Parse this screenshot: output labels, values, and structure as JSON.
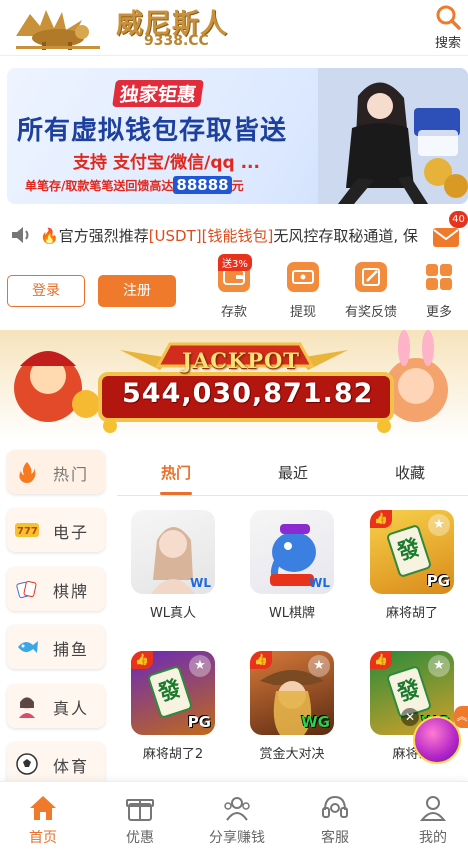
{
  "header": {
    "brand": "威尼斯人",
    "domain": "9338.CC",
    "search_label": "搜索"
  },
  "banner": {
    "tag": "独家钜惠",
    "headline": "所有虚拟钱包存取皆送",
    "sub": "支持 支付宝/微信/qq ...",
    "note": "单笔存/取款笔笔送回馈高达",
    "amount": "88888",
    "unit": "元"
  },
  "notice": {
    "prefix": "官方强烈推荐",
    "hl1": "[USDT]",
    "hl2": "[钱能钱包]",
    "rest": "无风控存取秘通道, 保",
    "mail_badge": "40"
  },
  "auth": {
    "login": "登录",
    "register": "注册"
  },
  "quick_actions": [
    {
      "label": "存款",
      "tag": "送3%"
    },
    {
      "label": "提现"
    },
    {
      "label": "有奖反馈"
    },
    {
      "label": "更多"
    }
  ],
  "jackpot": {
    "title": "JACKPOT",
    "value": "544,030,871.82"
  },
  "categories": [
    {
      "label": "热门"
    },
    {
      "label": "电子"
    },
    {
      "label": "棋牌"
    },
    {
      "label": "捕鱼"
    },
    {
      "label": "真人"
    },
    {
      "label": "体育"
    }
  ],
  "tabs": [
    {
      "label": "热门"
    },
    {
      "label": "最近"
    },
    {
      "label": "收藏"
    }
  ],
  "games": [
    {
      "name": "WL真人",
      "provider": "WL"
    },
    {
      "name": "WL棋牌",
      "provider": "WL"
    },
    {
      "name": "麻将胡了",
      "provider": "PG"
    },
    {
      "name": "麻将胡了2",
      "provider": "PG"
    },
    {
      "name": "赏金大对决",
      "provider": "WG"
    },
    {
      "name": "麻将胡",
      "provider": "WG"
    }
  ],
  "nav": [
    {
      "label": "首页"
    },
    {
      "label": "优惠"
    },
    {
      "label": "分享赚钱"
    },
    {
      "label": "客服"
    },
    {
      "label": "我的"
    }
  ],
  "colors": {
    "accent": "#e8702a",
    "red": "#e0281f",
    "blue": "#1d3f9e"
  }
}
